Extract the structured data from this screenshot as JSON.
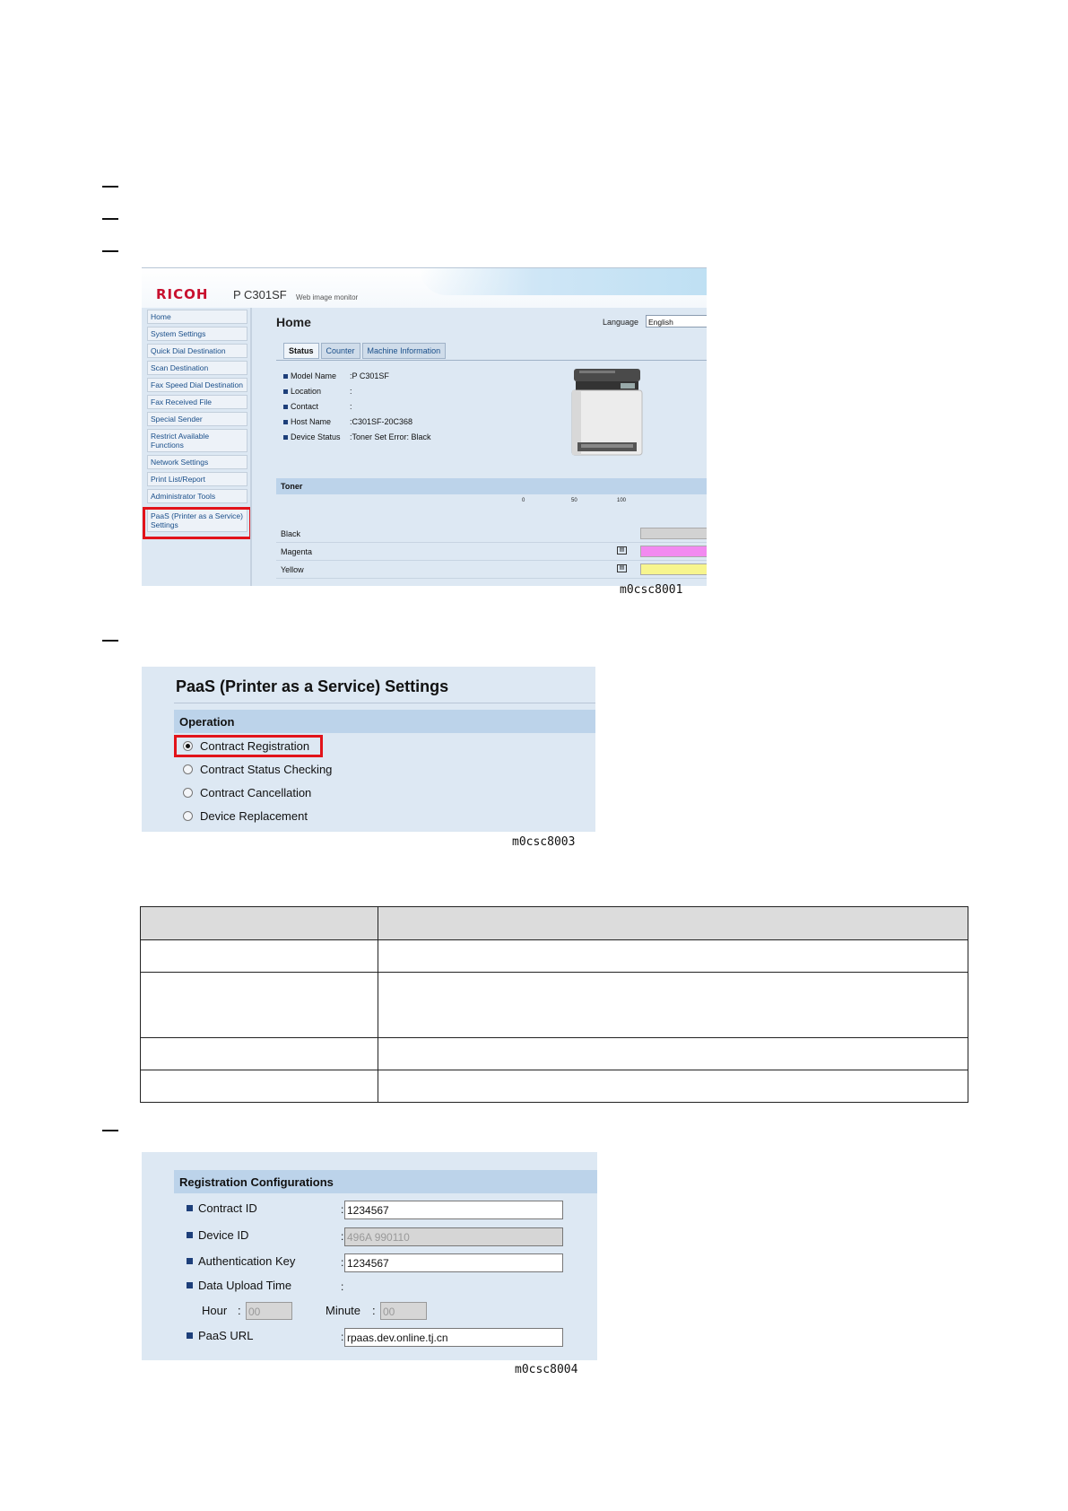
{
  "screenshot1": {
    "logo": "RICOH",
    "model": "P C301SF",
    "subtitle": "Web image monitor",
    "sidebar": [
      "Home",
      "System Settings",
      "Quick Dial Destination",
      "Scan Destination",
      "Fax Speed Dial Destination",
      "Fax Received File",
      "Special Sender",
      "Restrict Available Functions",
      "Network Settings",
      "Print List/Report",
      "Administrator Tools",
      "PaaS (Printer as a Service) Settings"
    ],
    "page_title": "Home",
    "language_label": "Language",
    "language_value": "English",
    "tabs": [
      "Status",
      "Counter",
      "Machine Information"
    ],
    "info": [
      {
        "key": "Model Name",
        "value": ":P C301SF"
      },
      {
        "key": "Location",
        "value": ":"
      },
      {
        "key": "Contact",
        "value": ":"
      },
      {
        "key": "Host Name",
        "value": ":C301SF-20C368"
      },
      {
        "key": "Device Status",
        "value": ":Toner Set Error: Black"
      }
    ],
    "toner_header": "Toner",
    "toner_scale": [
      "0",
      "50",
      "100"
    ],
    "toner": [
      {
        "name": "Black",
        "level": 0,
        "color": "#cccccc",
        "icon": false
      },
      {
        "name": "Magenta",
        "level": 100,
        "color": "#f28af0",
        "icon": true
      },
      {
        "name": "Yellow",
        "level": 100,
        "color": "#f7f58e",
        "icon": true
      }
    ],
    "caption": "m0csc8001"
  },
  "screenshot2": {
    "title": "PaaS (Printer as a Service) Settings",
    "section": "Operation",
    "options": [
      {
        "label": "Contract Registration",
        "selected": true
      },
      {
        "label": "Contract Status Checking",
        "selected": false
      },
      {
        "label": "Contract Cancellation",
        "selected": false
      },
      {
        "label": "Device Replacement",
        "selected": false
      }
    ],
    "caption": "m0csc8003"
  },
  "table": {
    "rows": [
      {
        "c1": "",
        "c2": ""
      },
      {
        "c1": "",
        "c2": ""
      },
      {
        "c1": "",
        "c2": ""
      },
      {
        "c1": "",
        "c2": ""
      }
    ]
  },
  "screenshot3": {
    "section": "Registration Configurations",
    "contract_id_label": "Contract ID",
    "contract_id_value": "1234567",
    "device_id_label": "Device ID",
    "device_id_value": "496A 990110",
    "auth_key_label": "Authentication Key",
    "auth_key_value": "1234567",
    "upload_time_label": "Data Upload Time",
    "hour_label": "Hour",
    "hour_value": "00",
    "minute_label": "Minute",
    "minute_value": "00",
    "paas_url_label": "PaaS URL",
    "paas_url_value": "rpaas.dev.online.tj.cn",
    "caption": "m0csc8004"
  }
}
